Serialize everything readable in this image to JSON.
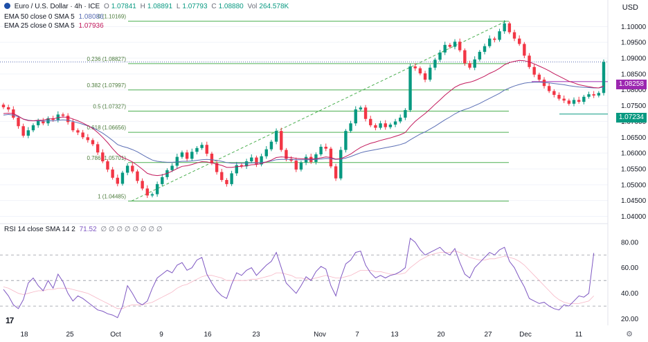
{
  "header": {
    "symbol": "Euro / U.S. Dollar · 4h · ICE",
    "ohlc": [
      {
        "k": "O",
        "v": "1.07841"
      },
      {
        "k": "H",
        "v": "1.08891"
      },
      {
        "k": "L",
        "v": "1.07793"
      },
      {
        "k": "C",
        "v": "1.08880"
      }
    ],
    "vol_label": "Vol",
    "vol": "264.578K",
    "ema1_label": "EMA 50 close 0 SMA 5",
    "ema1_value": "1.08086",
    "ema2_label": "EMA 25 close 0 SMA 5",
    "ema2_value": "1.07936",
    "currency": "USD"
  },
  "rsi_header": {
    "label": "RSI 14 close SMA 14 2",
    "value": "71.52",
    "extras": "∅ ∅ ∅ ∅ ∅ ∅ ∅ ∅"
  },
  "colors": {
    "up": "#089981",
    "down": "#f23645",
    "ema50": "#5b6fb5",
    "ema25": "#c2185b",
    "fib": "#4caf50",
    "rsi": "#7e57c2",
    "tag_purple": "#9c27b0",
    "tag_teal": "#089981"
  },
  "logo_text": "17",
  "chart_data": {
    "type": "candlestick",
    "y_axis_labels": [
      "1.10000",
      "1.09500",
      "1.09000",
      "1.08500",
      "1.08000",
      "1.07500",
      "1.07000",
      "1.06500",
      "1.06000",
      "1.05500",
      "1.05000",
      "1.04500",
      "1.04000"
    ],
    "ylim": [
      1.0388,
      1.1062
    ],
    "x_axis_labels": [
      "18",
      "25",
      "Oct",
      "9",
      "16",
      "23",
      "Nov",
      "7",
      "13",
      "20",
      "27",
      "Dec",
      "11"
    ],
    "fib_levels": [
      {
        "ratio": "0",
        "price": 1.10169,
        "label": "0 (1.10169)"
      },
      {
        "ratio": "0.236",
        "price": 1.08827,
        "label": "0.236 (1.08827)"
      },
      {
        "ratio": "0.382",
        "price": 1.07997,
        "label": "0.382 (1.07997)"
      },
      {
        "ratio": "0.5",
        "price": 1.07327,
        "label": "0.5 (1.07327)"
      },
      {
        "ratio": "0.618",
        "price": 1.06656,
        "label": "0.618 (1.06656)"
      },
      {
        "ratio": "0.786",
        "price": 1.05701,
        "label": "0.786 (1.05701)"
      },
      {
        "ratio": "1",
        "price": 1.04485,
        "label": "1 (1.04485)"
      }
    ],
    "price_tags": [
      {
        "value": "1.08258",
        "price": 1.08258,
        "color": "#9c27b0"
      },
      {
        "value": "1.07234",
        "price": 1.07234,
        "color": "#089981"
      }
    ],
    "close_price": 1.0888,
    "close_series": [
      1.0745,
      1.0738,
      1.0712,
      1.0685,
      1.0655,
      1.0672,
      1.0688,
      1.0701,
      1.0694,
      1.071,
      1.0705,
      1.0722,
      1.0718,
      1.0698,
      1.0672,
      1.0665,
      1.065,
      1.0641,
      1.0628,
      1.0602,
      1.0574,
      1.0548,
      1.0522,
      1.0503,
      1.0538,
      1.056,
      1.0542,
      1.0512,
      1.0488,
      1.0466,
      1.047,
      1.0502,
      1.0524,
      1.0546,
      1.056,
      1.0588,
      1.0602,
      1.0582,
      1.0604,
      1.0616,
      1.0626,
      1.0598,
      1.0568,
      1.054,
      1.0515,
      1.0502,
      1.0536,
      1.0562,
      1.0558,
      1.0574,
      1.0586,
      1.0564,
      1.059,
      1.0612,
      1.0636,
      1.067,
      1.061,
      1.0582,
      1.0576,
      1.0548,
      1.057,
      1.0588,
      1.0572,
      1.0596,
      1.062,
      1.0614,
      1.0558,
      1.052,
      1.061,
      1.067,
      1.0694,
      1.0738,
      1.0744,
      1.0708,
      1.0688,
      1.068,
      1.0694,
      1.0682,
      1.069,
      1.07,
      1.0712,
      1.0736,
      1.0874,
      1.0868,
      1.0852,
      1.0832,
      1.087,
      1.0895,
      1.0918,
      1.0942,
      1.0936,
      1.0952,
      1.0925,
      1.0884,
      1.087,
      1.0896,
      1.092,
      1.0938,
      1.0962,
      1.0958,
      1.0985,
      1.101,
      1.0982,
      1.0962,
      1.0945,
      1.0908,
      1.0872,
      1.0848,
      1.0832,
      1.0812,
      1.0796,
      1.0784,
      1.0772,
      1.0766,
      1.0756,
      1.0768,
      1.0762,
      1.0778,
      1.0786,
      1.0782,
      1.079,
      1.0888
    ],
    "ema50_series": [
      1.072,
      1.0722,
      1.072,
      1.0715,
      1.0708,
      1.0704,
      1.0702,
      1.0702,
      1.0701,
      1.0702,
      1.0702,
      1.0704,
      1.0705,
      1.0704,
      1.07,
      1.0696,
      1.0691,
      1.0686,
      1.068,
      1.0672,
      1.0663,
      1.0652,
      1.064,
      1.0627,
      1.0621,
      1.0617,
      1.0611,
      1.0604,
      1.0595,
      1.0586,
      1.0578,
      1.0574,
      1.0572,
      1.0571,
      1.0571,
      1.0572,
      1.0574,
      1.0574,
      1.0575,
      1.0577,
      1.0579,
      1.058,
      1.0579,
      1.0577,
      1.0574,
      1.057,
      1.0568,
      1.0568,
      1.0568,
      1.0568,
      1.0569,
      1.0569,
      1.057,
      1.0572,
      1.0575,
      1.0579,
      1.058,
      1.058,
      1.058,
      1.0579,
      1.0579,
      1.0579,
      1.0579,
      1.058,
      1.0581,
      1.0583,
      1.0582,
      1.058,
      1.0581,
      1.0584,
      1.0589,
      1.0595,
      1.0601,
      1.0605,
      1.0608,
      1.0611,
      1.0614,
      1.0617,
      1.062,
      1.0623,
      1.0627,
      1.0632,
      1.0642,
      1.0651,
      1.066,
      1.0667,
      1.0676,
      1.0685,
      1.0695,
      1.0705,
      1.0714,
      1.0724,
      1.0732,
      1.0738,
      1.0743,
      1.075,
      1.0757,
      1.0765,
      1.0773,
      1.0781,
      1.0789,
      1.0799,
      1.0806,
      1.0812,
      1.0817,
      1.0821,
      1.0823,
      1.0824,
      1.0824,
      1.0823,
      1.0822,
      1.082,
      1.0818,
      1.0816,
      1.0813,
      1.0811,
      1.0809,
      1.0808,
      1.0807,
      1.0806,
      1.0806,
      1.0809
    ],
    "ema25_series": [
      1.0725,
      1.0726,
      1.0725,
      1.0717,
      1.0707,
      1.0703,
      1.0702,
      1.0704,
      1.0704,
      1.0708,
      1.0708,
      1.0712,
      1.0714,
      1.0713,
      1.0708,
      1.0702,
      1.0695,
      1.0687,
      1.0678,
      1.0665,
      1.065,
      1.0633,
      1.0614,
      1.0597,
      1.0586,
      1.058,
      1.0572,
      1.0561,
      1.0549,
      1.0536,
      1.0531,
      1.0529,
      1.0531,
      1.0536,
      1.0543,
      1.0551,
      1.0558,
      1.056,
      1.0564,
      1.0569,
      1.0573,
      1.0572,
      1.0569,
      1.0565,
      1.0561,
      1.0555,
      1.0555,
      1.0557,
      1.0558,
      1.056,
      1.0563,
      1.0564,
      1.0567,
      1.0572,
      1.0578,
      1.0586,
      1.0588,
      1.0587,
      1.0586,
      1.0583,
      1.0582,
      1.0582,
      1.0581,
      1.0582,
      1.0585,
      1.0588,
      1.0586,
      1.0581,
      1.0582,
      1.0589,
      1.0597,
      1.0608,
      1.0618,
      1.0625,
      1.0631,
      1.0635,
      1.064,
      1.0644,
      1.0648,
      1.0653,
      1.0658,
      1.0665,
      1.0684,
      1.07,
      1.0713,
      1.0725,
      1.0739,
      1.0754,
      1.0768,
      1.0783,
      1.0796,
      1.0808,
      1.0816,
      1.0821,
      1.0824,
      1.0829,
      1.0836,
      1.0843,
      1.0852,
      1.0859,
      1.0868,
      1.0879,
      1.0886,
      1.089,
      1.0893,
      1.0892,
      1.0888,
      1.0882,
      1.0875,
      1.0868,
      1.086,
      1.0851,
      1.0843,
      1.0835,
      1.0827,
      1.0822,
      1.0816,
      1.0813,
      1.081,
      1.0807,
      1.0806,
      1.0812
    ],
    "rsi_axis_labels": [
      "80.00",
      "60.00",
      "40.00",
      "20.00"
    ],
    "rsi_ylim": [
      16,
      88
    ],
    "rsi_series": [
      43,
      38,
      31,
      28,
      35,
      48,
      52,
      46,
      42,
      50,
      44,
      55,
      49,
      40,
      34,
      38,
      36,
      33,
      30,
      27,
      26,
      24,
      23,
      21,
      30,
      46,
      40,
      33,
      31,
      34,
      44,
      52,
      55,
      58,
      56,
      62,
      64,
      58,
      60,
      66,
      68,
      55,
      48,
      42,
      38,
      36,
      47,
      56,
      54,
      58,
      60,
      54,
      58,
      62,
      65,
      72,
      60,
      48,
      44,
      40,
      46,
      53,
      50,
      57,
      61,
      59,
      46,
      38,
      52,
      63,
      66,
      72,
      73,
      62,
      56,
      52,
      54,
      52,
      54,
      55,
      57,
      60,
      83,
      80,
      74,
      70,
      72,
      74,
      76,
      72,
      70,
      75,
      64,
      55,
      52,
      60,
      64,
      68,
      72,
      70,
      74,
      76,
      65,
      60,
      52,
      45,
      36,
      34,
      32,
      33,
      30,
      28,
      27,
      31,
      30,
      34,
      38,
      37,
      40,
      71.52
    ],
    "rsi_sma_series": [
      45,
      44,
      42,
      40,
      39,
      40,
      41,
      42,
      42,
      43,
      43,
      44,
      44,
      44,
      43,
      42,
      41,
      40,
      38,
      36,
      34,
      32,
      30,
      28,
      28,
      30,
      31,
      31,
      31,
      32,
      33,
      35,
      37,
      39,
      41,
      44,
      46,
      47,
      49,
      51,
      53,
      54,
      54,
      53,
      52,
      50,
      50,
      50,
      50,
      50,
      51,
      51,
      52,
      53,
      54,
      56,
      56,
      55,
      54,
      52,
      52,
      51,
      51,
      52,
      53,
      54,
      53,
      52,
      52,
      53,
      54,
      56,
      58,
      58,
      58,
      57,
      57,
      56,
      55,
      55,
      55,
      56,
      60,
      63,
      66,
      68,
      70,
      71,
      72,
      72,
      72,
      73,
      72,
      70,
      68,
      67,
      66,
      66,
      67,
      67,
      68,
      69,
      68,
      67,
      65,
      62,
      58,
      54,
      50,
      46,
      42,
      38,
      35,
      33,
      32,
      32,
      32,
      33,
      34,
      38
    ]
  }
}
